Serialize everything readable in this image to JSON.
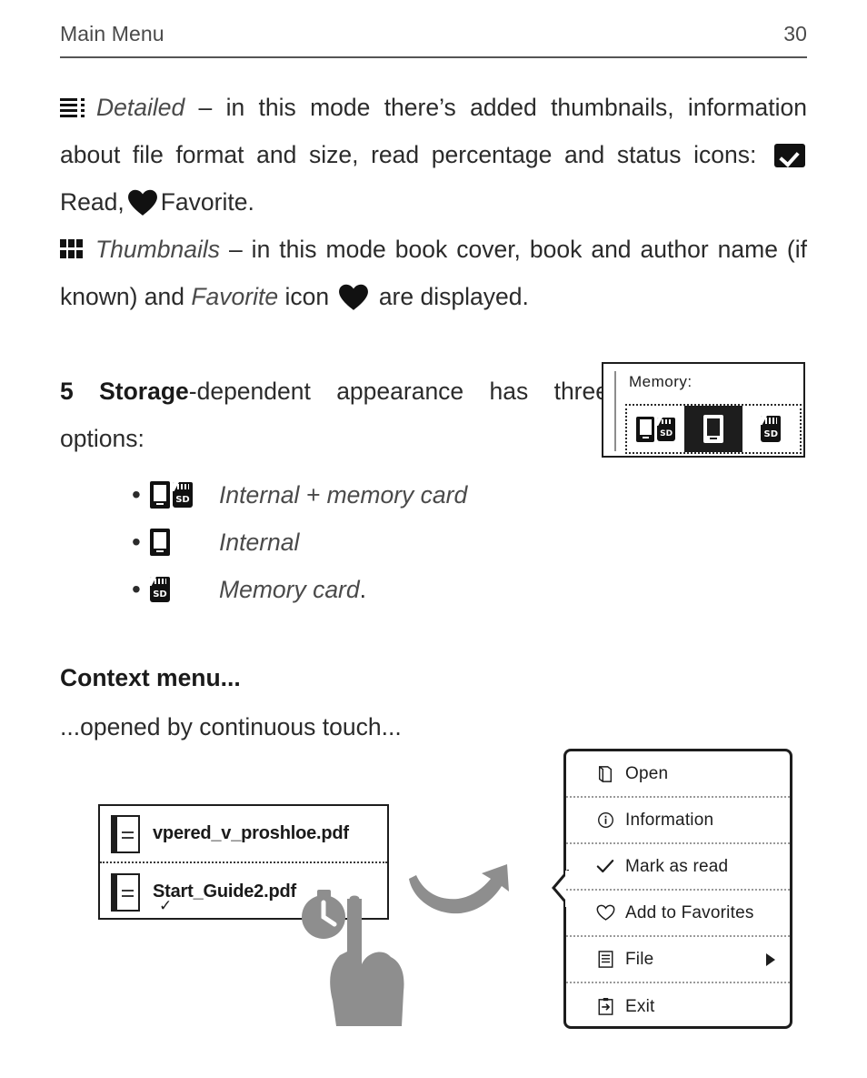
{
  "header": {
    "title": "Main Menu",
    "page_number": "30"
  },
  "body": {
    "detailed": {
      "icon": "detailed-list-icon",
      "term": "Detailed",
      "text_1": " – in this mode there’s added thumbnails, information about file format and size, read percentage and status icons: ",
      "read_label": "Read,",
      "favorite_label": "Favorite."
    },
    "thumbnails": {
      "icon": "grid-thumbnails-icon",
      "term": "Thumbnails",
      "text_1": " – in this mode book cover, book and author name (if known) and ",
      "favorite_term": "Favorite",
      "text_2": " icon ",
      "text_3": " are displayed."
    },
    "storage": {
      "number": "5",
      "term": "Storage",
      "text": "-dependent appearance has three options:",
      "options": [
        {
          "icon": "device-and-sd-icon",
          "label": "Internal + memory card",
          "period": ""
        },
        {
          "icon": "device-icon",
          "label": "Internal",
          "period": ""
        },
        {
          "icon": "sd-card-icon",
          "label": "Memory card",
          "period": "."
        }
      ]
    }
  },
  "memory_widget": {
    "label": "Memory:",
    "options": [
      {
        "icon": "device-and-sd-icon",
        "selected": false
      },
      {
        "icon": "device-icon",
        "selected": true
      },
      {
        "icon": "sd-card-icon",
        "selected": false
      }
    ],
    "sd_text": "SD"
  },
  "context_section": {
    "heading": "Context menu...",
    "subtitle": "...opened by continuous touch..."
  },
  "file_list": {
    "rows": [
      {
        "icon": "document-icon",
        "name": "vpered_v_proshloe.pdf",
        "check": ""
      },
      {
        "icon": "document-icon",
        "name": "Start_Guide2.pdf",
        "check": "✓"
      }
    ]
  },
  "context_menu": {
    "items": [
      {
        "icon": "open-book-icon",
        "label": "Open",
        "submenu": false
      },
      {
        "icon": "info-circle-icon",
        "label": "Information",
        "submenu": false
      },
      {
        "icon": "check-icon",
        "label": "Mark as read",
        "submenu": false
      },
      {
        "icon": "heart-outline-icon",
        "label": "Add to Favorites",
        "submenu": false
      },
      {
        "icon": "file-list-icon",
        "label": "File",
        "submenu": true
      },
      {
        "icon": "exit-icon",
        "label": "Exit",
        "submenu": false
      }
    ]
  },
  "annotations": {
    "hand_icon": "pointing-hand-icon",
    "stopwatch_icon": "stopwatch-icon",
    "arrow_icon": "curved-arrow-icon"
  },
  "colors": {
    "text": "#2b2b2b",
    "muted": "#4a4a4a",
    "ink": "#1d1d1d",
    "gray_graphic": "#8e8e8e"
  }
}
